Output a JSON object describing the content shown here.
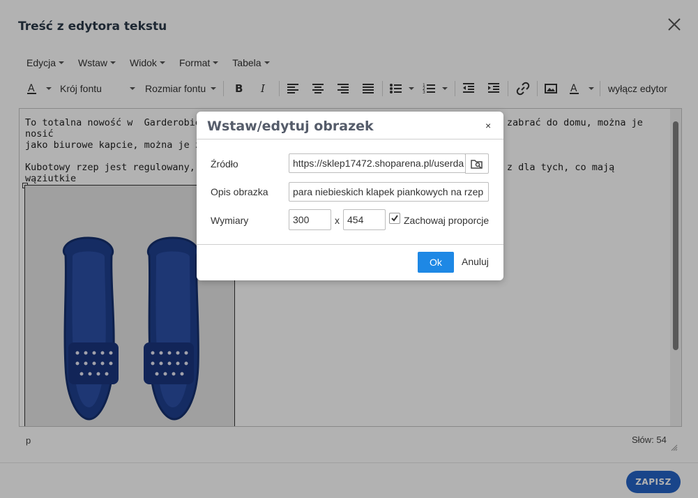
{
  "window": {
    "title": "Treść z edytora tekstu"
  },
  "menu": [
    "Edycja",
    "Wstaw",
    "Widok",
    "Format",
    "Tabela"
  ],
  "toolbar": {
    "font_family": "Krój fontu",
    "font_size": "Rozmiar fontu",
    "disable_editor": "wyłącz edytor"
  },
  "content": {
    "paragraph1": "To totalna nowość w  Garderobie S                                                    zabrać do domu, można je nosić\njako biurowe kapcie, można je zab",
    "paragraph2": "Kubotowy rzep jest regulowany, wi                                                    z dla tych, co mają wąziutkie\nlub szerokie stopy."
  },
  "statusbar": {
    "element_path": "p",
    "word_count": "Słów: 54"
  },
  "footer": {
    "save_label": "ZAPISZ"
  },
  "dialog": {
    "title": "Wstaw/edytuj obrazek",
    "close": "×",
    "source_label": "Źródło",
    "source_value": "https://sklep17472.shoparena.pl/userda",
    "description_label": "Opis obrazka",
    "description_value": "para niebieskich klapek piankowych na rzep",
    "dimensions_label": "Wymiary",
    "width_value": "300",
    "times": "x",
    "height_value": "454",
    "constrain_label": "Zachowaj proporcje",
    "constrain_checked": true,
    "ok_label": "Ok",
    "cancel_label": "Anuluj"
  },
  "colors": {
    "accent": "#1e88e5",
    "save": "#2563c6",
    "sandal": "#1f3f8f"
  }
}
